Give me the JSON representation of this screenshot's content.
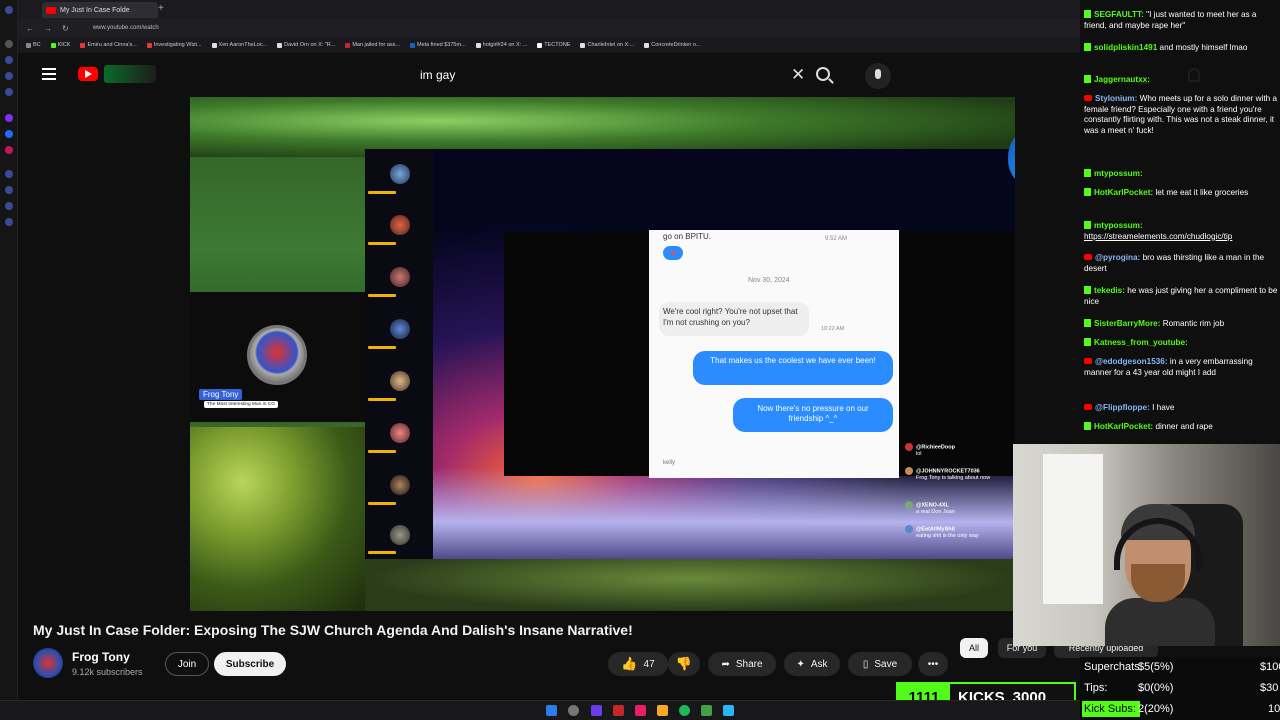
{
  "browser": {
    "tab_title": "My Just In Case Folde",
    "url": "www.youtube.com/watch",
    "bookmarks": [
      "BC",
      "KICK",
      "Emiru and Cinna's...",
      "Investigating Wizt...",
      "Xen AaronTheLoc...",
      "David Orn on X: \"R...",
      "Man jailed for ass...",
      "Meta fined $375m...",
      "hotgirl#24 on X: ...",
      "TECTONE",
      "CharlieIntel on X:...",
      "ConcreteDrinker o..."
    ]
  },
  "search": {
    "query": "im gay"
  },
  "video": {
    "host_name": "Frog Tony",
    "host_subtitle": "The Most Interesting Man in CG",
    "phone": {
      "top_text": "go on BPITU.",
      "top_time": "9:52 AM",
      "date": "Nov 30, 2024",
      "grey_bubble": "We're cool right? You're not upset that I'm not crushing on you?",
      "grey_time": "10:22 AM",
      "blue_bubble_1": "That makes us the coolest we have ever been!",
      "blue_bubble_2": "Now there's no pressure on our friendship ^_^",
      "footer": "kelly"
    },
    "stream_chat": [
      {
        "user": "@RichieeDoop",
        "text": "lol"
      },
      {
        "user": "@JOHNNYROCKET7036",
        "text": "Frog Tony is talking about now"
      },
      {
        "user": "@XENO-4XL",
        "text": "a real Don Juan"
      },
      {
        "user": "@EatAllMyShit",
        "text": "eating shit is the only way"
      }
    ]
  },
  "title": "My Just In Case Folder: Exposing The SJW Church Agenda And Dalish's Insane Narrative!",
  "channel": {
    "name": "Frog Tony",
    "subscribers": "9.12k subscribers",
    "join": "Join",
    "subscribe": "Subscribe"
  },
  "actions": {
    "likes": "47",
    "share": "Share",
    "ask": "Ask",
    "save": "Save"
  },
  "chips": {
    "all": "All",
    "for_you": "For you",
    "recent": "Recently uploaded"
  },
  "chat": [
    {
      "platform": "kick",
      "user": "SEGFAULTT:",
      "text": "\"I just wanted to meet her as a friend, and maybe rape her\"",
      "color": "#53fc18"
    },
    {
      "platform": "kick",
      "user": "solidpliskin1491",
      "text": "and mostly himself lmao",
      "color": "#53fc18"
    },
    {
      "platform": "kick",
      "user": "Jaggernautxx:",
      "text": "",
      "color": "#53fc18"
    },
    {
      "platform": "youtube",
      "user": "Stylonium:",
      "text": "Who meets up for a solo dinner with a female friend? Especially one with a friend you're constantly flirting with. This was not a steak dinner, it was a meet n' fuck!",
      "color": "#8ab4f8"
    },
    {
      "platform": "kick",
      "user": "mtypossum:",
      "text": "",
      "color": "#53fc18"
    },
    {
      "platform": "kick",
      "user": "HotKarlPocket:",
      "text": "let me eat it like groceries",
      "color": "#53fc18"
    },
    {
      "platform": "kick",
      "user": "mtypossum:",
      "text": "https://streamelements.com/chudlogic/tip",
      "color": "#53fc18"
    },
    {
      "platform": "youtube",
      "user": "@pyrogina:",
      "text": "bro was thirsting like a man in the desert",
      "color": "#8ab4f8"
    },
    {
      "platform": "kick",
      "user": "tekedis:",
      "text": "he was just giving her a compliment to be nice",
      "color": "#53fc18"
    },
    {
      "platform": "kick",
      "user": "SisterBarryMore:",
      "text": "Romantic rim job",
      "color": "#53fc18"
    },
    {
      "platform": "kick",
      "user": "Katness_from_youtube:",
      "text": "",
      "color": "#53fc18"
    },
    {
      "platform": "youtube",
      "user": "@edodgeson1536:",
      "text": "in a very embarrassing manner for a 43 year old might I add",
      "color": "#8ab4f8"
    },
    {
      "platform": "youtube",
      "user": "@Flippfloppe:",
      "text": "I have",
      "color": "#8ab4f8"
    },
    {
      "platform": "kick",
      "user": "HotKarlPocket:",
      "text": "dinner and rape",
      "color": "#53fc18"
    }
  ],
  "goals": [
    {
      "label": "Superchats:",
      "value": "$5(5%)",
      "target": "$100"
    },
    {
      "label": "Tips:",
      "value": "$0(0%)",
      "target": "$30"
    },
    {
      "label": "Kick Subs:",
      "value": "2(20%)",
      "target": "10"
    }
  ],
  "kicks_bar": {
    "count": "1111",
    "label": "KICKS",
    "target": "3000"
  },
  "colors": {
    "kick_green": "#53fc18",
    "yt_red": "#ff0000",
    "bg": "#0f0f0f"
  }
}
